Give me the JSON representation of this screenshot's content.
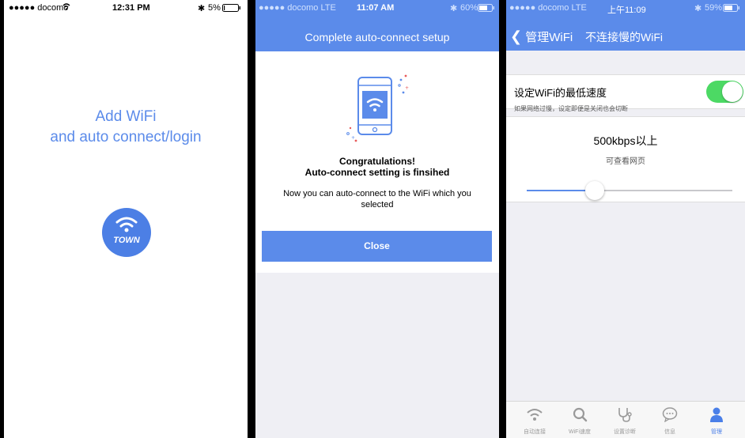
{
  "colors": {
    "accent": "#5b8bea",
    "toggle_on": "#4cd964",
    "background": "#efeff4"
  },
  "screen1": {
    "status": {
      "carrier": "●●●●● docomo",
      "time": "12:31 PM",
      "battery": "5%"
    },
    "title_line1": "Add WiFi",
    "title_line2": "and auto connect/login",
    "logo_text": "TOWN"
  },
  "screen2": {
    "status": {
      "carrier": "●●●●● docomo  LTE",
      "time": "11:07 AM",
      "battery": "60%"
    },
    "header_title": "Complete auto-connect setup",
    "congrats_line1": "Congratulations!",
    "congrats_line2": "Auto-connect setting is finsihed",
    "message_line1": "Now you can auto-connect to the WiFi which you",
    "message_line2": "selected",
    "close_label": "Close"
  },
  "screen3": {
    "status": {
      "carrier": "●●●●● docomo  LTE",
      "time": "上午11:09",
      "battery": "59%"
    },
    "back_label": "管理WiFi",
    "title": "不连接慢的WiFi",
    "setting_label": "设定WiFi的最低速度",
    "setting_on": true,
    "hint": "如果网络过慢，设定即便是关闭也会切断",
    "speed_value": "500kbps以上",
    "speed_desc": "可查看网页",
    "slider_fraction": 0.33,
    "tabs": [
      {
        "label": "自动连接",
        "icon": "wifi-icon",
        "active": false
      },
      {
        "label": "WiFi速度",
        "icon": "search-icon",
        "active": false
      },
      {
        "label": "设置诊断",
        "icon": "stethoscope-icon",
        "active": false
      },
      {
        "label": "信息",
        "icon": "chat-bubble-icon",
        "active": false
      },
      {
        "label": "管理",
        "icon": "person-icon",
        "active": true
      }
    ]
  }
}
